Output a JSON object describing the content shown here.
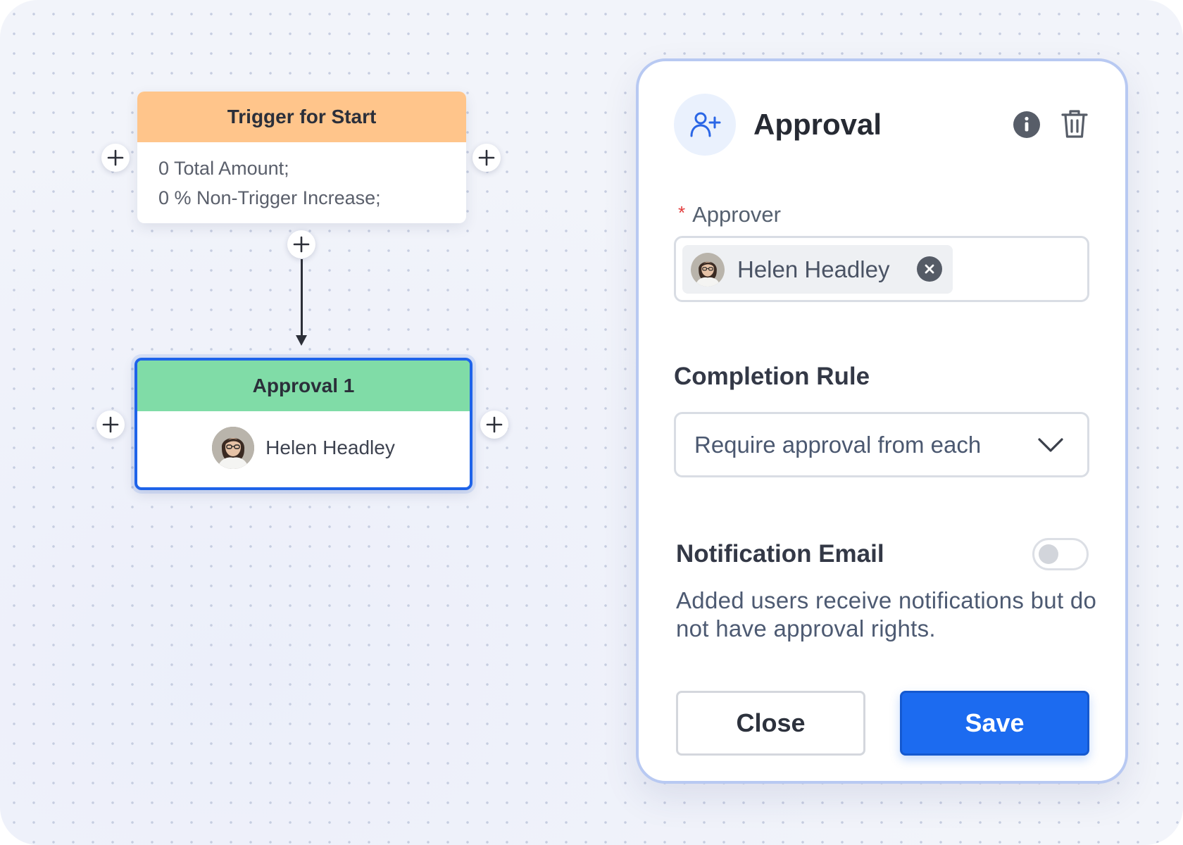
{
  "flow": {
    "trigger_node": {
      "title": "Trigger for Start",
      "lines": [
        "0 Total Amount;",
        "0 % Non-Trigger Increase;"
      ]
    },
    "approval_node": {
      "title": "Approval 1",
      "approver_name": "Helen Headley"
    }
  },
  "panel": {
    "title": "Approval",
    "approver": {
      "required_marker": "*",
      "label": "Approver",
      "selected": "Helen Headley"
    },
    "completion_rule": {
      "title": "Completion Rule",
      "selected_option": "Require approval from each"
    },
    "notification_email": {
      "title": "Notification Email",
      "enabled": false,
      "description": "Added users receive notifications but do not have approval rights."
    },
    "buttons": {
      "close": "Close",
      "save": "Save"
    }
  },
  "icons": {
    "header": "add-user-icon",
    "info": "info-icon",
    "delete": "trash-icon",
    "chip_remove": "close-icon",
    "dropdown": "chevron-down-icon",
    "add_node": "plus-icon"
  },
  "colors": {
    "trigger_header": "#ffc58b",
    "approval_header": "#80dca7",
    "selected_node_border": "#1e63e9",
    "primary": "#1c6bf0",
    "required": "#e23b3b"
  }
}
